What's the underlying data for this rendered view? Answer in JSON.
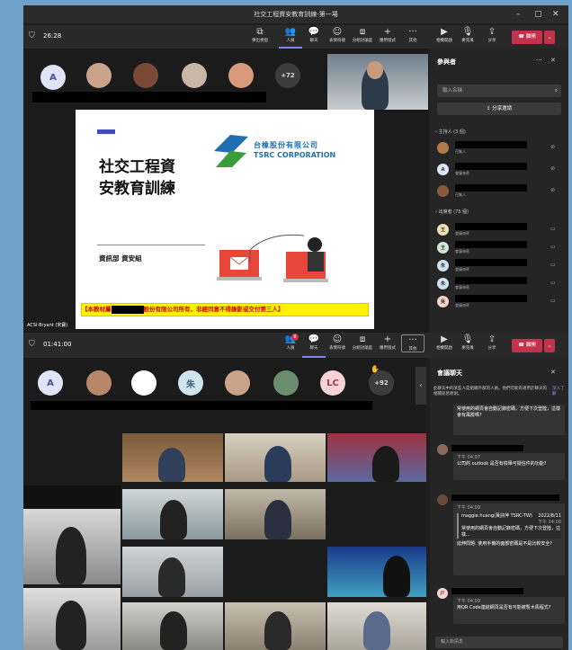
{
  "window": {
    "title": "社交工程資安教育訓練-第一場",
    "min": "–",
    "max": "▢",
    "close": "✕"
  },
  "top": {
    "timer": "26:28",
    "tools": [
      "彈出視窗",
      "人員",
      "聊天",
      "表情符號",
      "分組討論區",
      "應用程式",
      "其他",
      "相機開啟",
      "麥克風",
      "分享"
    ],
    "leave": "離開",
    "plus_count": "+72",
    "avatar_letter": "A"
  },
  "slide": {
    "title_line1": "社交工程資",
    "title_line2": "安教育訓練",
    "dept": "資訊部 資安組",
    "company_cn": "台橡股份有限公司",
    "company_en": "TSRC CORPORATION",
    "footer_left": "【本教材屬",
    "footer_right": "股份有限公司所有，非經同意不得錄影或交付第三人】",
    "presenter": "ACSI-Bryant (宋寶)"
  },
  "participants": {
    "title": "參與者",
    "search_placeholder": "輸入名稱",
    "share_invite": "分享邀請",
    "organizers_header": "主持人 (3 個)",
    "attendees_header": "出席者 (75 個)",
    "organizers": [
      {
        "initial": "",
        "role": "召集人",
        "color": "#b07a4a"
      },
      {
        "initial": "A",
        "role": "會議來賓",
        "color": "#dfe4f7"
      },
      {
        "initial": "",
        "role": "召集人",
        "color": "#8a5a3a"
      }
    ],
    "attendees": [
      {
        "initial": "王",
        "role": "會議來賓",
        "color": "#f1e0b6"
      },
      {
        "initial": "王",
        "role": "會議來賓",
        "color": "#cfe8d4"
      },
      {
        "initial": "朱",
        "role": "會議來賓",
        "color": "#cfe4ee"
      },
      {
        "initial": "朱",
        "role": "會議來賓",
        "color": "#cfe4ee"
      },
      {
        "initial": "吳",
        "role": "會議來賓",
        "color": "#f6d4c6"
      }
    ]
  },
  "bottom": {
    "timer": "01:41:00",
    "tools": [
      "人員",
      "聊天",
      "表情符號",
      "分組討論區",
      "應用程式",
      "其他",
      "相機開啟",
      "麥克風",
      "分享"
    ],
    "people_badge": "8",
    "leave": "離開",
    "plus_count": "+92",
    "avatars": [
      {
        "letter": "A",
        "color": "#dfe4f7"
      },
      {
        "letter": "朱",
        "color": "#cfe4ee"
      },
      {
        "letter": "LC",
        "color": "#f6d4d6"
      }
    ]
  },
  "chat": {
    "title": "會議聊天",
    "notice": "此聊天中的某些人是組織外部的人員。他們可能有適用於聊天的相關訊息原則。",
    "notice_link": "深入了解",
    "input_placeholder": "輸入新訊息",
    "messages": [
      {
        "avatar": "",
        "time": "",
        "text": "常使用的網頁會自動記錄密碼，方便下次登陸，這樣會有風險嗎?"
      },
      {
        "avatar": "",
        "time": "下午 04:07",
        "text": "公司的 outlook 是否有檢舉可疑信件的功能?"
      },
      {
        "avatar": "",
        "time": "下午 04:09",
        "quote_author": "maggie.huang(黃詩萍 TSRC-TW)",
        "quote_date": "2022/8/11",
        "quote_time": "下午 04:06",
        "quote_text": "常使用的網頁會自動記錄密碼，方便下次登陸，這樣...",
        "text": "延伸問題: 使用手機的面部密碼是不是比較安全?"
      },
      {
        "avatar": "JT",
        "time": "下午 04:09",
        "text": "用QR Code連結網頁是否有可能被暫木馬程式?"
      }
    ]
  },
  "colors": {
    "accent": "#c4314b",
    "toolbar": "#292929",
    "panel": "#252526",
    "brand": "#5558af"
  }
}
